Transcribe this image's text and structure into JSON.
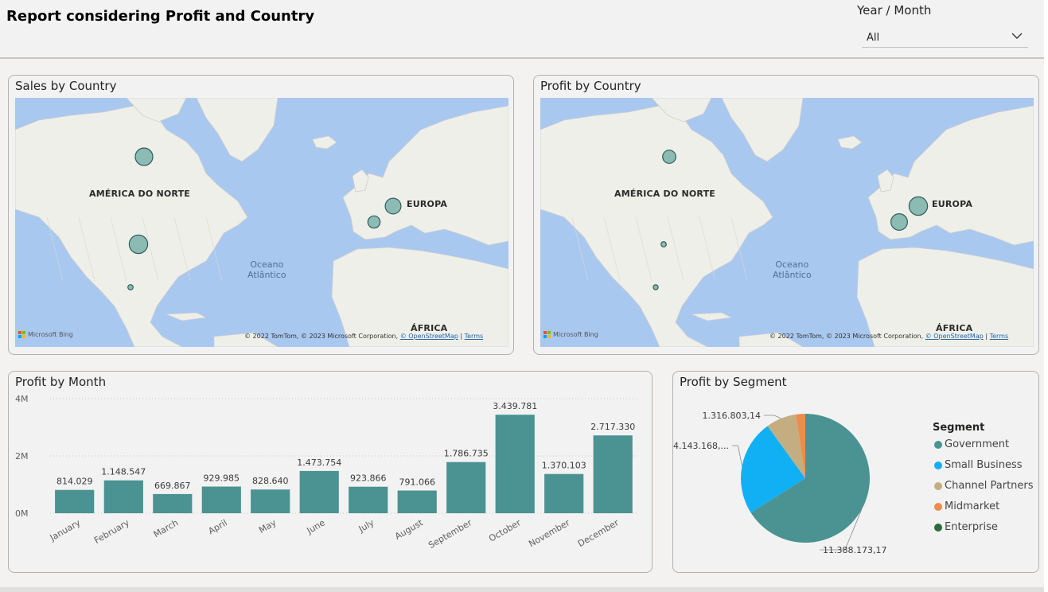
{
  "report": {
    "title": "Report considering Profit and Country"
  },
  "slicer": {
    "label": "Year / Month",
    "value": "All",
    "icon": "chevron-down-icon"
  },
  "maps": [
    {
      "title": "Sales by Country",
      "region_labels": [
        "AMÉRICA DO NORTE",
        "EUROPA",
        "ÁFRICA"
      ],
      "ocean_label_line1": "Oceano",
      "ocean_label_line2": "Atlântico",
      "bing_label": "Microsoft Bing",
      "copyright_text": "© 2022 TomTom, © 2023 Microsoft Corporation,",
      "osm_link": "© OpenStreetMap",
      "terms_link": "Terms",
      "bubble_sizes": [
        1.0,
        1.05,
        0.9,
        0.7,
        0.3
      ]
    },
    {
      "title": "Profit by Country",
      "region_labels": [
        "AMÉRICA DO NORTE",
        "EUROPA",
        "ÁFRICA"
      ],
      "ocean_label_line1": "Oceano",
      "ocean_label_line2": "Atlântico",
      "bing_label": "Microsoft Bing",
      "copyright_text": "© 2022 TomTom, © 2023 Microsoft Corporation,",
      "osm_link": "© OpenStreetMap",
      "terms_link": "Terms",
      "bubble_sizes": [
        0.75,
        0.3,
        1.05,
        0.95,
        0.28
      ]
    }
  ],
  "colors": {
    "teal": "#4a9392",
    "bubble_fill": "#7fb5ad",
    "bubble_stroke": "#2f5d5a",
    "cyan": "#11b0f5",
    "tan": "#c4ad80",
    "orange": "#ed8c4c",
    "green": "#2e6b3a",
    "ocean": "#a8c8f0",
    "land": "#efefe9"
  },
  "bar_card": {
    "title": "Profit by Month"
  },
  "pie_card": {
    "title": "Profit by Segment",
    "legend_title": "Segment"
  },
  "chart_data": [
    {
      "type": "bar",
      "title": "Profit by Month",
      "categories": [
        "January",
        "February",
        "March",
        "April",
        "May",
        "June",
        "July",
        "August",
        "September",
        "October",
        "November",
        "December"
      ],
      "values": [
        814029,
        1148547,
        669867,
        929985,
        828640,
        1473754,
        923866,
        791066,
        1786735,
        3439781,
        1370103,
        2717330
      ],
      "data_labels": [
        "814.029",
        "1.148.547",
        "669.867",
        "929.985",
        "828.640",
        "1.473.754",
        "923.866",
        "791.066",
        "1.786.735",
        "3.439.781",
        "1.370.103",
        "2.717.330"
      ],
      "ytick_labels": [
        "0M",
        "2M",
        "4M"
      ],
      "ylim": [
        0,
        4000000
      ],
      "grid": true
    },
    {
      "type": "pie",
      "title": "Profit by Segment",
      "categories": [
        "Government",
        "Small Business",
        "Channel Partners",
        "Midmarket",
        "Enterprise"
      ],
      "values": [
        11388173.17,
        4143168,
        1316803.14,
        400000,
        0
      ],
      "data_labels": [
        "11.388.173,17",
        "4.143.168,...",
        "1.316.803,14"
      ],
      "colors": [
        "#4a9392",
        "#11b0f5",
        "#c4ad80",
        "#ed8c4c",
        "#2e6b3a"
      ],
      "legend_position": "right"
    }
  ]
}
